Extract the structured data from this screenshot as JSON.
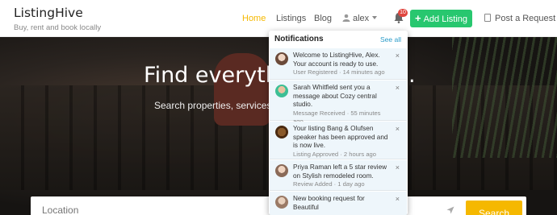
{
  "brand": {
    "name": "ListingHive",
    "tagline": "Buy, rent and book locally"
  },
  "nav": {
    "home": "Home",
    "listings": "Listings",
    "blog": "Blog",
    "user": "alex",
    "notification_count": "10",
    "add_listing": "Add Listing",
    "post_request": "Post a Request"
  },
  "hero": {
    "title_left": "Find everyth",
    "title_right": ".",
    "subtitle": "Search properties, services a"
  },
  "search": {
    "location_placeholder": "Location",
    "button": "Search"
  },
  "notifications": {
    "title": "Notifications",
    "see_all": "See all",
    "items": [
      {
        "text": "Welcome to ListingHive, Alex. Your account is ready to use.",
        "meta": "User Registered · 14 minutes ago",
        "avatar_color": "#c99a7a"
      },
      {
        "text": "Sarah Whitfield sent you a message about Cozy central studio.",
        "meta": "Message Received · 55 minutes ago",
        "avatar_color": "#3cbf95"
      },
      {
        "text": "Your listing Bang & Olufsen speaker has been approved and is now live.",
        "meta": "Listing Approved · 2 hours ago",
        "avatar_color": "#7a4a1c"
      },
      {
        "text": "Priya Raman left a 5 star review on Stylish remodeled room.",
        "meta": "Review Added · 1 day ago",
        "avatar_color": "#c4a894"
      },
      {
        "text": "New booking request for Beautiful",
        "meta": "",
        "avatar_color": "#b09680"
      }
    ],
    "close_symbol": "×"
  },
  "colors": {
    "accent": "#f5b800",
    "green": "#28c76f",
    "badge": "#e0463f",
    "link": "#2a9bc9"
  }
}
